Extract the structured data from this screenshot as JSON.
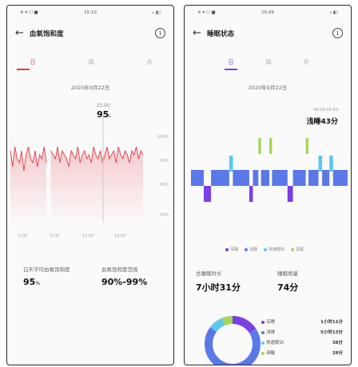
{
  "left_phone": {
    "status": {
      "left": "※ ▾ ☐ ■",
      "time": "15:10",
      "right": "⁎ ▮▯"
    },
    "title": "血氧饱和度",
    "tabs": [
      "日",
      "周",
      "月"
    ],
    "active_tab": 0,
    "date": "2020年9月22日",
    "tooltip_time": "15:00",
    "tooltip_value": "95",
    "tooltip_unit": "%",
    "y_ticks": [
      "100%",
      "95%",
      "90%",
      "70%"
    ],
    "x_ticks": [
      "0:00",
      "6:00",
      "12:00",
      "18:00"
    ],
    "stat1_label": "白天平均血氧饱和度",
    "stat1_value": "95",
    "stat1_unit": "%",
    "stat2_label": "血氧饱和度范围",
    "stat2_value": "90%-99%",
    "accent": "#e53945"
  },
  "right_phone": {
    "status": {
      "left": "※ ▾ ☐ ■",
      "time": "15:09",
      "right": "⁎ ▮▯"
    },
    "title": "睡眠状态",
    "tabs": [
      "日",
      "周",
      "月"
    ],
    "active_tab": 0,
    "date": "2020年9月22日",
    "tooltip_label": "00:00-00:43",
    "tooltip_value": "浅睡43分",
    "legend": [
      "深睡",
      "浅睡",
      "快速眼动",
      "清醒"
    ],
    "legend_colors": [
      "#7b3fe4",
      "#5b78e8",
      "#5bc8f0",
      "#a5d65b"
    ],
    "stat1_label": "总睡眠时长",
    "stat1_value": "7小时31分",
    "stat2_label": "睡眠质量",
    "stat2_value": "74分",
    "breakdown": [
      {
        "name": "深睡",
        "value": "1小时11分"
      },
      {
        "name": "浅睡",
        "value": "5小时13分"
      },
      {
        "name": "快速眼动",
        "value": "38分"
      },
      {
        "name": "清醒",
        "value": "29分"
      }
    ]
  },
  "chart_data": [
    {
      "type": "line",
      "title": "",
      "xlabel": "",
      "ylabel": "",
      "x_ticks": [
        "0:00",
        "6:00",
        "12:00",
        "18:00"
      ],
      "y_ticks": [
        "100%",
        "95%",
        "90%",
        "70%"
      ],
      "series": [
        {
          "values": [
            96,
            92,
            97,
            94,
            93,
            96,
            91,
            95,
            97,
            94,
            93,
            96,
            92,
            95,
            94,
            97,
            93,
            92,
            96,
            95,
            94,
            97,
            93,
            96,
            95,
            94,
            92,
            96,
            95,
            94,
            97,
            93,
            95,
            96,
            94,
            95,
            93,
            97,
            95,
            94,
            96,
            93,
            95,
            97,
            94,
            95,
            96,
            93,
            97,
            95,
            94,
            96,
            95,
            93,
            96,
            95,
            97,
            94,
            96,
            95
          ]
        }
      ],
      "tooltip": {
        "time": "15:00",
        "value": 95
      },
      "grid": true
    },
    {
      "type": "bar",
      "title": "",
      "legend": [
        "深睡",
        "浅睡",
        "快速眼动",
        "清醒"
      ],
      "segments": [
        {
          "stage": "浅睡",
          "start": 0,
          "end": 14
        },
        {
          "stage": "深睡",
          "start": 14,
          "end": 22
        },
        {
          "stage": "浅睡",
          "start": 22,
          "end": 42
        },
        {
          "stage": "快速眼动",
          "start": 42,
          "end": 46
        },
        {
          "stage": "浅睡",
          "start": 46,
          "end": 64
        },
        {
          "stage": "深睡",
          "start": 64,
          "end": 68
        },
        {
          "stage": "浅睡",
          "start": 68,
          "end": 74
        },
        {
          "stage": "清醒",
          "start": 74,
          "end": 77
        },
        {
          "stage": "浅睡",
          "start": 77,
          "end": 86
        },
        {
          "stage": "清醒",
          "start": 86,
          "end": 89
        },
        {
          "stage": "浅睡",
          "start": 89,
          "end": 106
        },
        {
          "stage": "深睡",
          "start": 106,
          "end": 112
        },
        {
          "stage": "浅睡",
          "start": 112,
          "end": 126
        },
        {
          "stage": "清醒",
          "start": 126,
          "end": 129
        },
        {
          "stage": "浅睡",
          "start": 129,
          "end": 140
        },
        {
          "stage": "快速眼动",
          "start": 140,
          "end": 144
        },
        {
          "stage": "浅睡",
          "start": 144,
          "end": 152
        },
        {
          "stage": "快速眼动",
          "start": 152,
          "end": 156
        },
        {
          "stage": "浅睡",
          "start": 156,
          "end": 172
        }
      ]
    },
    {
      "type": "pie",
      "title": "",
      "categories": [
        "深睡",
        "浅睡",
        "快速眼动",
        "清醒"
      ],
      "values": [
        71,
        313,
        38,
        29
      ]
    }
  ]
}
